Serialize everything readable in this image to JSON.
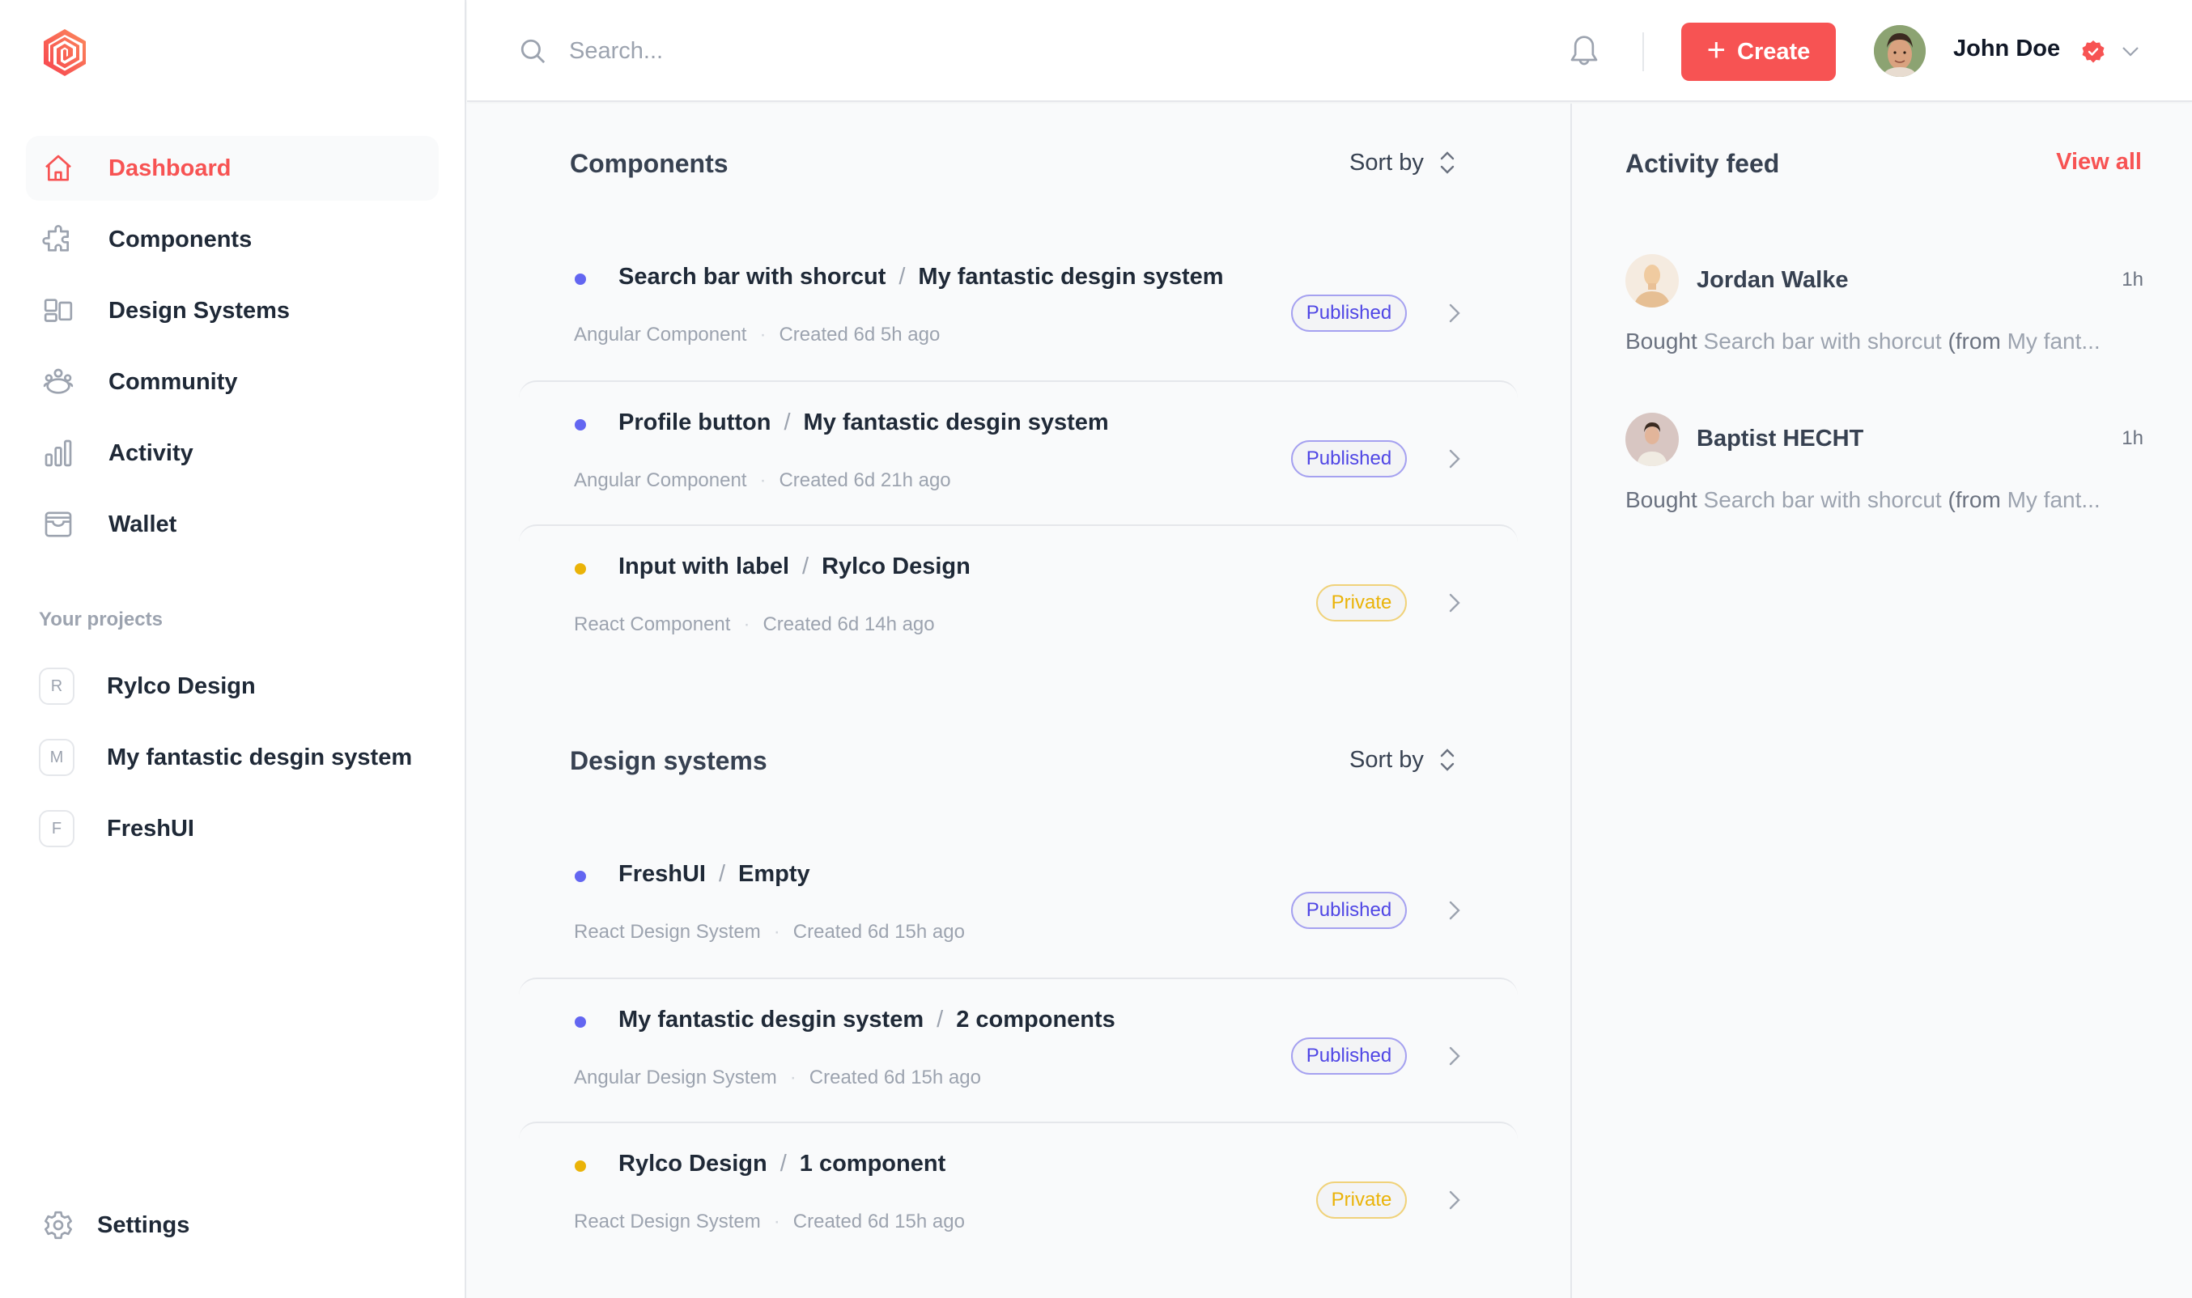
{
  "colors": {
    "accent": "#f75353",
    "published": "#4f46e5",
    "private": "#eab308",
    "dot_published": "#6366f1",
    "dot_private": "#eab308"
  },
  "sidebar": {
    "logo": "brand-logo",
    "nav": [
      {
        "label": "Dashboard",
        "icon": "home-icon",
        "active": true
      },
      {
        "label": "Components",
        "icon": "puzzle-icon",
        "active": false
      },
      {
        "label": "Design Systems",
        "icon": "layout-icon",
        "active": false
      },
      {
        "label": "Community",
        "icon": "users-icon",
        "active": false
      },
      {
        "label": "Activity",
        "icon": "bar-chart-icon",
        "active": false
      },
      {
        "label": "Wallet",
        "icon": "wallet-icon",
        "active": false
      }
    ],
    "projects_label": "Your projects",
    "projects": [
      {
        "initial": "R",
        "label": "Rylco Design"
      },
      {
        "initial": "M",
        "label": "My fantastic desgin system"
      },
      {
        "initial": "F",
        "label": "FreshUI"
      }
    ],
    "settings_label": "Settings"
  },
  "header": {
    "search_placeholder": "Search...",
    "search_value": "",
    "create_label": "Create",
    "user_name": "John Doe"
  },
  "components": {
    "title": "Components",
    "sort_label": "Sort by",
    "rows": [
      {
        "name": "Search bar with shorcut",
        "parent": "My fantastic desgin system",
        "type": "Angular Component",
        "created": "Created 6d 5h ago",
        "status": "Published"
      },
      {
        "name": "Profile button",
        "parent": "My fantastic desgin system",
        "type": "Angular Component",
        "created": "Created 6d 21h ago",
        "status": "Published"
      },
      {
        "name": "Input with label",
        "parent": "Rylco Design",
        "type": "React Component",
        "created": "Created 6d 14h ago",
        "status": "Private"
      }
    ]
  },
  "design_systems": {
    "title": "Design systems",
    "sort_label": "Sort by",
    "rows": [
      {
        "name": "FreshUI",
        "parent": "Empty",
        "type": "React Design System",
        "created": "Created 6d 15h ago",
        "status": "Published"
      },
      {
        "name": "My fantastic desgin system",
        "parent": "2 components",
        "type": "Angular Design System",
        "created": "Created 6d 15h ago",
        "status": "Published"
      },
      {
        "name": "Rylco Design",
        "parent": "1 component",
        "type": "React Design System",
        "created": "Created 6d 15h ago",
        "status": "Private"
      }
    ]
  },
  "activity": {
    "title": "Activity feed",
    "view_all": "View all",
    "items": [
      {
        "name": "Jordan Walke",
        "time": "1h",
        "verb": "Bought",
        "item": "Search bar with shorcut",
        "from_label": "(from",
        "from": "My fant..."
      },
      {
        "name": "Baptist HECHT",
        "time": "1h",
        "verb": "Bought",
        "item": "Search bar with shorcut",
        "from_label": "(from",
        "from": "My fant..."
      }
    ]
  }
}
